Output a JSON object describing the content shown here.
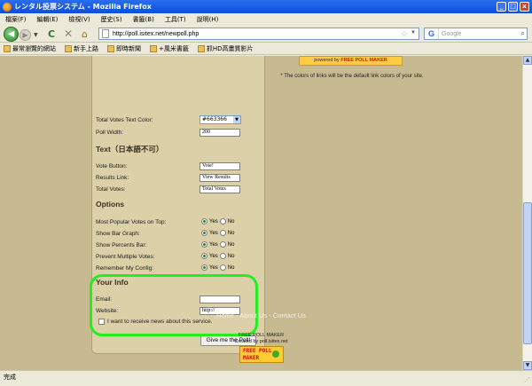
{
  "window": {
    "title": "レンタル投票システム - Mozilla Firefox",
    "min": "_",
    "max": "□",
    "close": "x"
  },
  "menu": [
    "檔案(F)",
    "編輯(E)",
    "檢視(V)",
    "歷史(S)",
    "書籤(B)",
    "工具(T)",
    "說明(H)"
  ],
  "nav": {
    "url": "http://poll.isitex.net/newpoll.php",
    "search_placeholder": "Google",
    "search_logo": "G"
  },
  "bookmarks": [
    "最常瀏覽的網站",
    "新手上路",
    "即時新聞",
    "+風米書籤",
    "抓HD高畫質影片"
  ],
  "form": {
    "total_votes_color_label": "Total Votes Text Color:",
    "total_votes_color_value": "#663366",
    "poll_width_label": "Poll Width:",
    "poll_width_value": "200",
    "text_heading": "Text（日本語不可）",
    "vote_button_label": "Vote Button:",
    "vote_button_value": "Vote!",
    "results_link_label": "Results Link:",
    "results_link_value": "View Results",
    "total_votes_label": "Total Votes:",
    "total_votes_value": "Total Votes",
    "options_heading": "Options",
    "options": [
      {
        "label": "Most Popular Votes on Top:",
        "selected": "Yes"
      },
      {
        "label": "Show Bar Graph:",
        "selected": "Yes"
      },
      {
        "label": "Show Percents Bar:",
        "selected": "Yes"
      },
      {
        "label": "Prevent Multiple Votes:",
        "selected": "Yes"
      },
      {
        "label": "Remember My Config:",
        "selected": "Yes"
      }
    ],
    "yes": "Yes",
    "no": "No",
    "info_heading": "Your Info",
    "email_label": "Email:",
    "email_value": "",
    "website_label": "Website:",
    "website_value": "http://",
    "news_label": "I want to receive news about this service.",
    "submit": "Give me the Poll!"
  },
  "preview": {
    "powered_prefix": "powered by",
    "powered_brand": "FREE POLL MAKER",
    "note": "* The colors of links will be the default link colors of your site."
  },
  "footer": {
    "links": "Home - About Us - Contact Us",
    "title": "FREE POLL MAKER",
    "created": "Created by poll.isitex.net",
    "logo_line1": "FREE POLL",
    "logo_line2": "MAKER"
  },
  "status": "完成"
}
